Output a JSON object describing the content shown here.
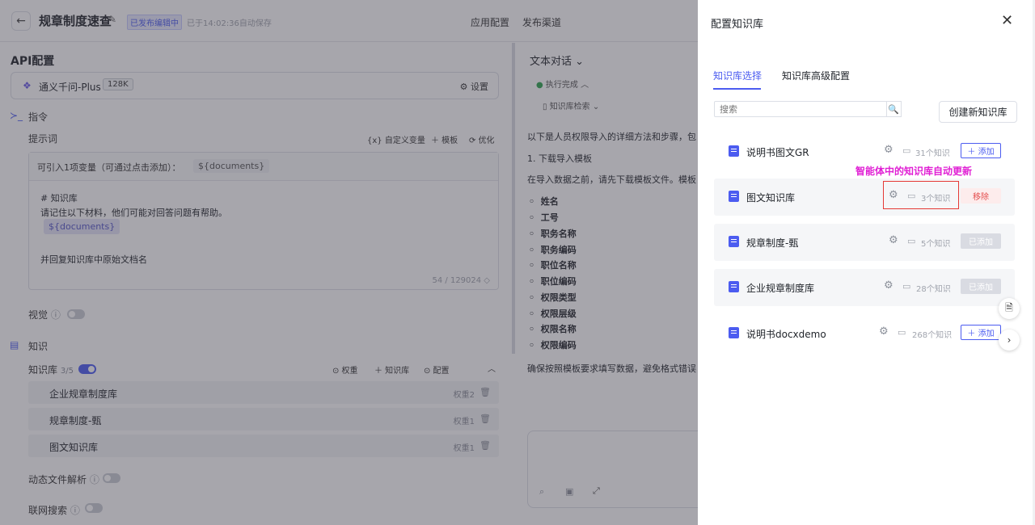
{
  "header": {
    "back_icon": "←",
    "title": "规章制度速查",
    "edit_icon": "✎",
    "badge": "已发布编辑中",
    "autosave": "已于14:02:36自动保存",
    "links": [
      "应用配置",
      "发布渠道"
    ]
  },
  "left": {
    "api_title": "API配置",
    "model": {
      "icon": "❖",
      "name": "通义千问-Plus",
      "context": "128K",
      "settings": "⚙ 设置"
    },
    "instruction_label": "指令",
    "prompt_label": "提示词",
    "actions": {
      "custom_var": "{x} 自定义变量",
      "template": "＋ 模板",
      "optimize": "优化"
    },
    "prompt_header_text": "可引入1项变量（可通过点击添加）：",
    "prompt_header_var": "${documents}",
    "prompt_lines": [
      "# 知识库",
      "请记住以下材料，他们可能对回答问题有帮助。",
      "并回复知识库中原始文档名"
    ],
    "prompt_var_chip": "${documents}",
    "counter": "54 / 129024 ◇",
    "vision_label": "视觉",
    "knowledge_title": "知识",
    "kb_label": "知识库",
    "kb_count": "3/5",
    "kb_actions": {
      "weight": "⊙ 权重",
      "add": "＋ 知识库",
      "config": "⊙ 配置",
      "collapse": "︿"
    },
    "kb_rows": [
      {
        "name": "企业规章制度库",
        "weight": "权重2",
        "delete": "🗑"
      },
      {
        "name": "规章制度-甄",
        "weight": "权重1",
        "delete": "🗑"
      },
      {
        "name": "图文知识库",
        "weight": "权重1",
        "delete": "🗑"
      }
    ],
    "dynamic_parse": "动态文件解析",
    "web_search": "联网搜索"
  },
  "right": {
    "head": "文本对话 ⌄",
    "exec": "执行完成 ︿",
    "kb_search": "知识库检索 ⌄",
    "intro": "以下是人员权限导入的详细方法和步骤，包",
    "step1": "1. 下载导入模板",
    "step1_text": "在导入数据之前，请先下载模板文件。模板",
    "bullets": [
      "姓名",
      "工号",
      "职务名称",
      "职务编码",
      "职位名称",
      "职位编码",
      "权限类型",
      "权限层级",
      "权限名称",
      "权限编码"
    ],
    "closing": "确保按照模板要求填写数据，避免格式错误"
  },
  "drawer": {
    "title": "配置知识库",
    "close": "✕",
    "tabs": [
      "知识库选择",
      "知识库高级配置"
    ],
    "search_placeholder": "搜索",
    "search_icon": "🔍",
    "create_button": "创建新知识库",
    "annotation": "智能体中的知识库自动更新",
    "items": [
      {
        "name": "说明书图文GR",
        "count": "31个知识",
        "button": "＋ 添加",
        "state": "add"
      },
      {
        "name": "图文知识库",
        "count": "3个知识",
        "button": "移除",
        "state": "remove"
      },
      {
        "name": "规章制度-甄",
        "count": "5个知识",
        "button": "已添加",
        "state": "added"
      },
      {
        "name": "企业规章制度库",
        "count": "28个知识",
        "button": "已添加",
        "state": "added"
      },
      {
        "name": "说明书docxdemo",
        "count": "268个知识",
        "button": "＋ 添加",
        "state": "add"
      }
    ],
    "float_doc_icon": "🗎",
    "float_next_icon": "›"
  },
  "colors": {
    "accent": "#4c5cf0",
    "annotation": "#e01fd4",
    "danger": "#e53935"
  }
}
